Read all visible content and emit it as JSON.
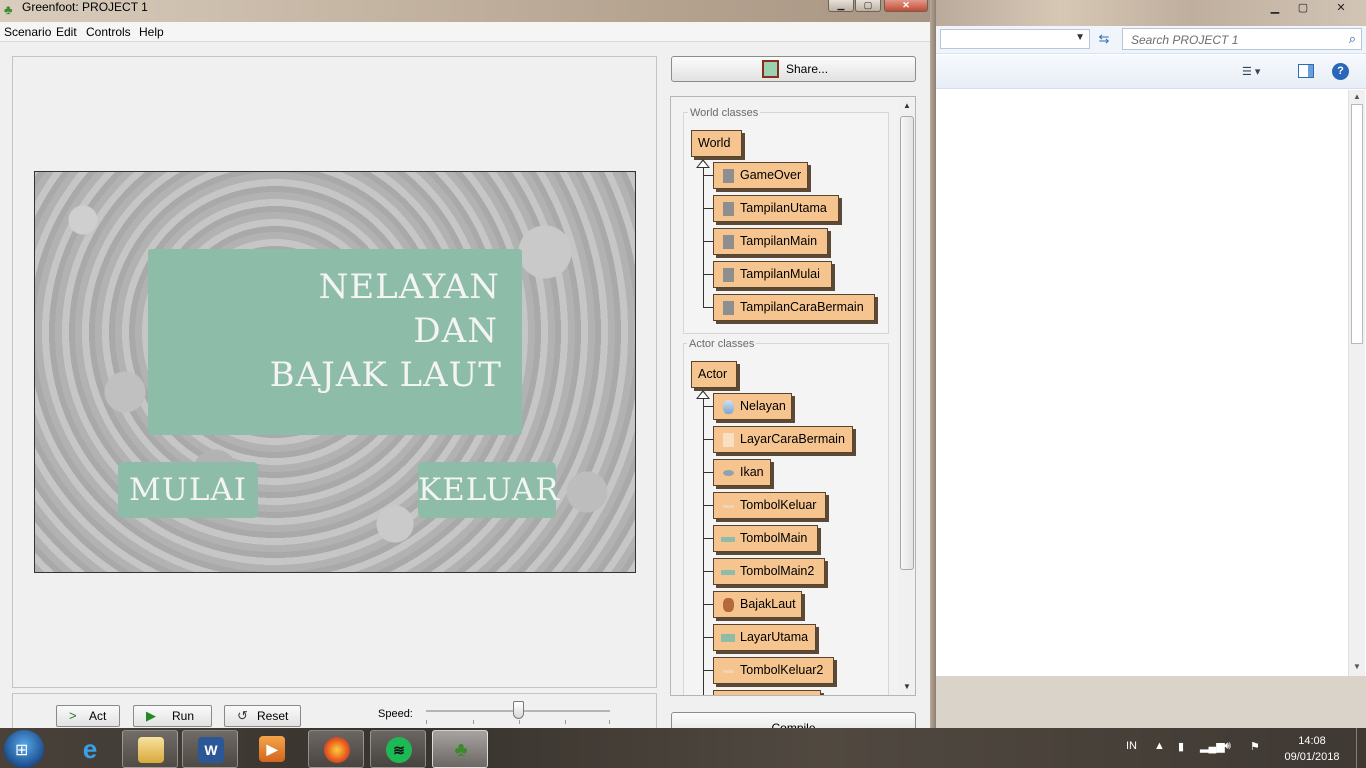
{
  "window": {
    "title": "Greenfoot: PROJECT 1",
    "controls": {
      "minimize": "▁",
      "maximize": "▢",
      "close": "✕"
    }
  },
  "menu": [
    "Scenario",
    "Edit",
    "Controls",
    "Help"
  ],
  "world": {
    "title_lines": [
      "NELAYAN",
      "DAN",
      "BAJAK LAUT"
    ],
    "buttons": {
      "start": "MULAI",
      "exit": "KELUAR"
    }
  },
  "toolbar": {
    "act": "Act",
    "run": "Run",
    "reset": "Reset",
    "speed_label": "Speed:",
    "speed_level": 0.5
  },
  "share_button": "Share...",
  "compile_button": "Compile",
  "world_classes": {
    "label": "World classes",
    "root": "World",
    "children": [
      "GameOver",
      "TampilanUtama",
      "TampilanMain",
      "TampilanMulai",
      "TampilanCaraBermain"
    ]
  },
  "actor_classes": {
    "label": "Actor classes",
    "root": "Actor",
    "children": [
      "Nelayan",
      "LayarCaraBermain",
      "Ikan",
      "TombolKeluar",
      "TombolMain",
      "TombolMain2",
      "BajakLaut",
      "LayarUtama",
      "TombolKeluar2"
    ]
  },
  "explorer": {
    "search_placeholder": "Search PROJECT 1",
    "help": "?"
  },
  "taskbar": {
    "apps": [
      "start-orb",
      "internet-explorer",
      "file-explorer",
      "word",
      "media-player",
      "firefox",
      "spotify",
      "greenfoot"
    ],
    "language": "IN",
    "time": "14:08",
    "date": "09/01/2018"
  },
  "colors": {
    "class_fill": "#f6c58f",
    "world_button": "#8dbca8",
    "title_bar": "#c4b4a2"
  }
}
